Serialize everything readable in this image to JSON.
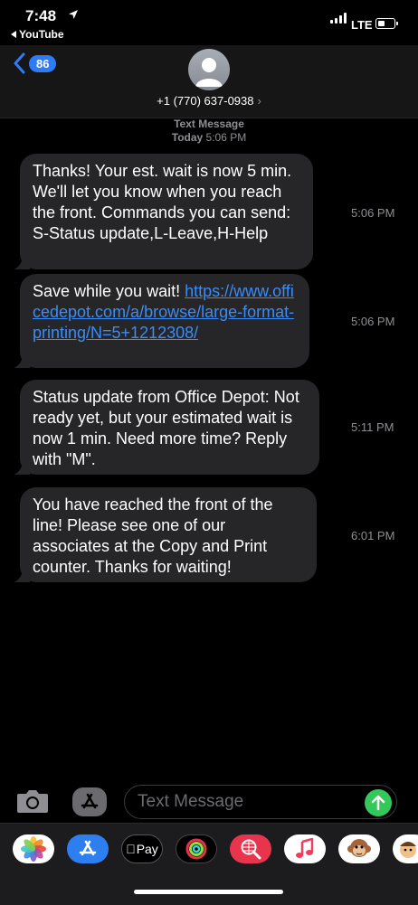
{
  "status_bar": {
    "time": "7:48",
    "back_app": "YouTube",
    "network": "LTE"
  },
  "header": {
    "unread_count": "86",
    "contact": "+1 (770) 637-0938"
  },
  "thread": {
    "label": "Text Message",
    "day": "Today",
    "time": "5:06 PM"
  },
  "messages": [
    {
      "text": "Thanks! Your est. wait is now 5 min. We'll let you know when you reach the front. Commands you can send: S-Status update,L-Leave,H-Help",
      "time": "5:06 PM"
    },
    {
      "text_before": "Save while you wait! ",
      "link": "https://www.officedepot.com/a/browse/large-format-printing/N=5+1212308/",
      "time": "5:06 PM"
    },
    {
      "text": "Status update from Office Depot: Not ready yet, but your estimated wait is now 1 min. Need more time? Reply with \"M\".",
      "time": "5:11 PM"
    },
    {
      "text": "You have reached the front of the line! Please see one of our associates at the Copy and Print counter. Thanks for waiting!",
      "time": "6:01 PM"
    }
  ],
  "composer": {
    "placeholder": "Text Message"
  },
  "drawer": {
    "apple_pay_label": "Pay"
  },
  "colors": {
    "bubble": "#262628",
    "link": "#3b8cf7",
    "badge": "#2f7bf5",
    "send": "#34c759"
  }
}
